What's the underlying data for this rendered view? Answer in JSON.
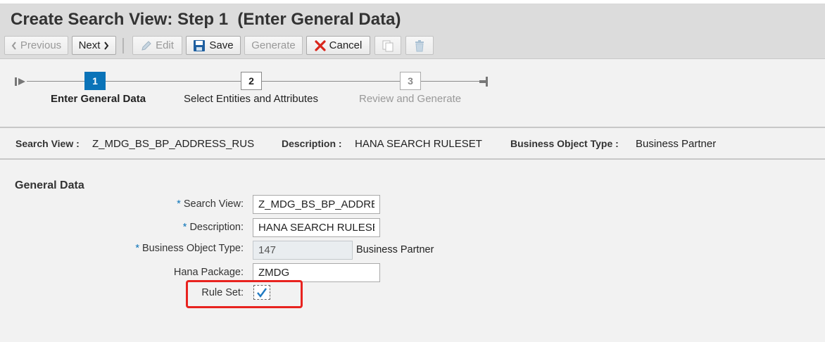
{
  "header": {
    "title": "Create Search View: Step 1  (Enter General Data)"
  },
  "toolbar": {
    "previous_label": "Previous",
    "next_label": "Next",
    "edit_label": "Edit",
    "save_label": "Save",
    "generate_label": "Generate",
    "cancel_label": "Cancel"
  },
  "steps": [
    {
      "number": "1",
      "label": "Enter General Data",
      "state": "active"
    },
    {
      "number": "2",
      "label": "Select Entities and Attributes",
      "state": "next"
    },
    {
      "number": "3",
      "label": "Review and Generate",
      "state": "future"
    }
  ],
  "info": {
    "search_view_label": "Search View :",
    "search_view_value": "Z_MDG_BS_BP_ADDRESS_RUS",
    "description_label": "Description :",
    "description_value": "HANA SEARCH RULESET",
    "bo_type_label": "Business Object Type :",
    "bo_type_value": "Business Partner"
  },
  "general": {
    "section_title": "General Data",
    "required_mark": "*",
    "search_view_label": "Search View:",
    "search_view_value": "Z_MDG_BS_BP_ADDRESS_RUS",
    "description_label": "Description:",
    "description_value": "HANA SEARCH RULESET",
    "bo_type_label": "Business Object Type:",
    "bo_type_value": "147",
    "bo_type_text": "Business Partner",
    "hana_package_label": "Hana Package:",
    "hana_package_value": "ZMDG",
    "rule_set_label": "Rule Set:",
    "rule_set_checked": true
  },
  "colors": {
    "active_step": "#0a73b8",
    "highlight_border": "#e8231f",
    "cancel_icon": "#d9261c"
  }
}
